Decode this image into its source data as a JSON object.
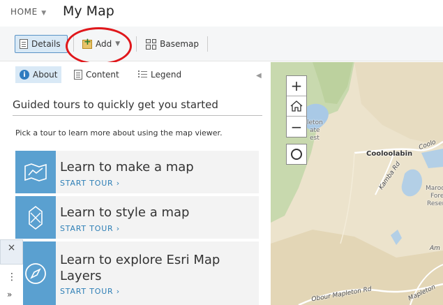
{
  "header": {
    "home_label": "HOME",
    "title": "My Map"
  },
  "toolbar": {
    "details_label": "Details",
    "add_label": "Add",
    "basemap_label": "Basemap"
  },
  "tabs": [
    {
      "label": "About",
      "icon": "info-icon"
    },
    {
      "label": "Content",
      "icon": "content-icon"
    },
    {
      "label": "Legend",
      "icon": "legend-icon"
    }
  ],
  "about": {
    "heading": "Guided tours to quickly get you started",
    "intro": "Pick a tour to learn more about using the map viewer.",
    "tours": [
      {
        "title": "Learn to make a map",
        "cta": "START TOUR ›",
        "icon": "map-icon"
      },
      {
        "title": "Learn to style a map",
        "cta": "START TOUR ›",
        "icon": "style-icon"
      },
      {
        "title": "Learn to explore Esri Map Layers",
        "cta": "START TOUR ›",
        "icon": "compass-icon"
      }
    ]
  },
  "mini_controls": {
    "close": "×",
    "more": "⋮",
    "expand": "»"
  },
  "map": {
    "zoom_in": "+",
    "zoom_out": "−",
    "labels": {
      "place_left_1": "leton",
      "place_left_2": "ate",
      "place_left_3": "est",
      "cooloolabin": "Cooloolabin",
      "cooloolabin_right": "Coolo",
      "road_diag": "Kamba Rd",
      "maroo_1": "Maroo",
      "maroo_2": "Fore",
      "maroo_3": "Reser",
      "road_bottom": "Obour Mapleton Rd",
      "road_bottom_right": "Mapleton",
      "right_edge": "Am"
    }
  },
  "colors": {
    "accent": "#2f7cc0",
    "card_icon_bg": "#5aa0d0",
    "highlight_circle": "#e0171b",
    "cta": "#2e7fb6"
  }
}
